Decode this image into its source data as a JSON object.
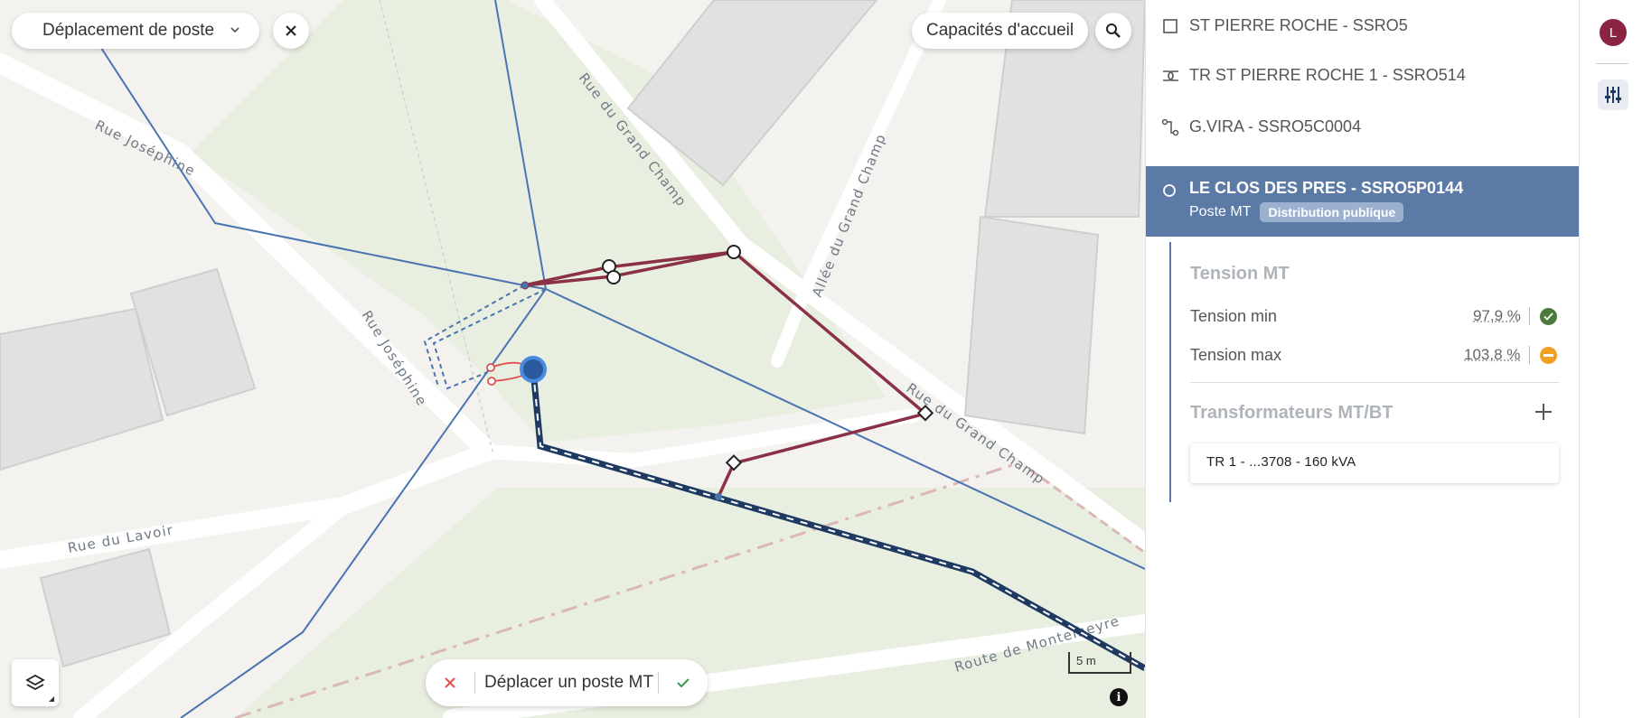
{
  "toolbar": {
    "mode_select_value": "Déplacement de poste",
    "capacities_label": "Capacités d'accueil"
  },
  "map": {
    "streets": [
      "Rue Joséphine",
      "Rue Joséphine",
      "Rue du Grand Champ",
      "Allée du Grand Champ",
      "Rue du Grand Champ",
      "Rue du Lavoir",
      "Route de Montelheyre"
    ],
    "scale_label": "5 m",
    "info_label": "i",
    "action_bar": {
      "label": "Déplacer un poste MT"
    }
  },
  "panel": {
    "tree": [
      {
        "label": "ST PIERRE ROCHE - SSRO5",
        "icon": "square-icon"
      },
      {
        "label": "TR ST PIERRE ROCHE 1 - SSRO514",
        "icon": "transformer-icon"
      },
      {
        "label": "G.VIRA - SSRO5C0004",
        "icon": "branch-icon"
      }
    ],
    "selected": {
      "title": "LE CLOS DES PRES - SSRO5P0144",
      "type": "Poste MT",
      "badge": "Distribution publique"
    },
    "tension": {
      "heading": "Tension MT",
      "min_label": "Tension min",
      "min_value": "97,9 %",
      "min_status": "ok",
      "max_label": "Tension max",
      "max_value": "103,8 %",
      "max_status": "warning"
    },
    "transformers": {
      "heading": "Transformateurs MT/BT",
      "items": [
        {
          "label": "TR 1 -  ...3708 -  160 kVA"
        }
      ]
    }
  },
  "rail": {
    "avatar_initial": "L"
  },
  "colors": {
    "accent": "#5b7aa5",
    "line_red": "#8b3146",
    "line_blue": "#4a74b0",
    "ok": "#4a7a3c",
    "warning": "#f0a020",
    "avatar": "#8a2440"
  }
}
